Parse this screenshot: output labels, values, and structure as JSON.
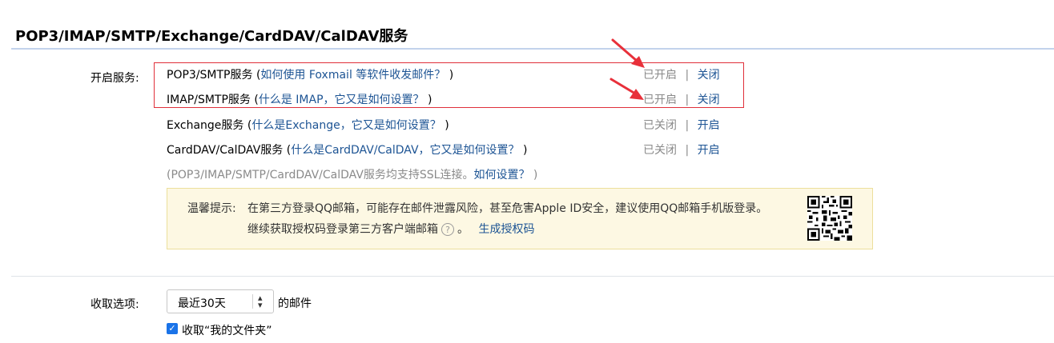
{
  "section": {
    "title": "POP3/IMAP/SMTP/Exchange/CardDAV/CalDAV服务"
  },
  "services": {
    "label": "开启服务:",
    "rows": [
      {
        "name": "POP3/SMTP服务",
        "open_paren": " (",
        "link": "如何使用 Foxmail 等软件收发邮件？",
        "close_paren": " )",
        "status": "已开启",
        "separator": "|",
        "action": "关闭"
      },
      {
        "name": "IMAP/SMTP服务",
        "open_paren": " (",
        "link": "什么是 IMAP，它又是如何设置？",
        "close_paren": " )",
        "status": "已开启",
        "separator": "|",
        "action": "关闭"
      },
      {
        "name": "Exchange服务",
        "open_paren": " (",
        "link": "什么是Exchange，它又是如何设置？",
        "close_paren": " )",
        "status": "已关闭",
        "separator": "|",
        "action": "开启"
      },
      {
        "name": "CardDAV/CalDAV服务",
        "open_paren": " (",
        "link": "什么是CardDAV/CalDAV，它又是如何设置？",
        "close_paren": " )",
        "status": "已关闭",
        "separator": "|",
        "action": "开启"
      }
    ],
    "ssl_prefix": "(POP3/IMAP/SMTP/CardDAV/CalDAV服务均支持SSL连接。",
    "ssl_link": "如何设置？",
    "ssl_suffix": " )"
  },
  "tip": {
    "prefix": "温馨提示:",
    "line1": "在第三方登录QQ邮箱，可能存在邮件泄露风险，甚至危害Apple ID安全，建议使用QQ邮箱手机版登录。",
    "line2": "继续获取授权码登录第三方客户端邮箱",
    "help_glyph": "?",
    "period": "。",
    "link": "生成授权码"
  },
  "receive": {
    "label": "收取选项:",
    "select_value": "最近30天",
    "suffix": "的邮件",
    "checkbox_label": "收取“我的文件夹”",
    "checkbox_checked": true
  },
  "colors": {
    "link": "#1d5494",
    "highlight_box": "#e0303a",
    "arrow": "#e8303a",
    "tip_background": "#fdf8e3",
    "tip_border": "#ecdf9c",
    "checkbox": "#1a73e8"
  },
  "icons": {
    "arrow_1": "red-arrow-icon",
    "arrow_2": "red-arrow-icon",
    "help": "question-circle-icon",
    "qr": "qr-code-icon",
    "select_caret": "up-down-caret-icon",
    "checkbox": "checkmark-icon"
  }
}
